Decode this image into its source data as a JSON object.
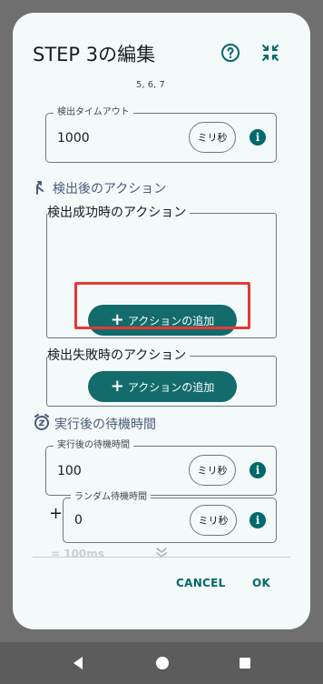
{
  "dialog": {
    "title": "STEP 3の編集",
    "help_icon": "help-circle-icon",
    "shrink_icon": "collapse-arrows-icon"
  },
  "partial_text": "5, 6, 7",
  "detection_timeout": {
    "label": "検出タイムアウト",
    "value": "1000",
    "unit": "ミリ秒",
    "info_icon": "info-icon"
  },
  "after_detection": {
    "title": "検出後のアクション",
    "icon": "branch-arrow-icon",
    "success": {
      "label": "検出成功時のアクション",
      "add_button": "アクションの追加"
    },
    "failure": {
      "label": "検出失敗時のアクション",
      "add_button": "アクションの追加"
    }
  },
  "wait": {
    "title": "実行後の待機時間",
    "icon": "alarm-snooze-icon",
    "wait_field": {
      "label": "実行後の待機時間",
      "value": "100",
      "unit": "ミリ秒"
    },
    "random_field": {
      "prefix": "+",
      "label": "ランダム待機時間",
      "value": "0",
      "unit": "ミリ秒"
    },
    "result": "= 100ms",
    "expand_icon": "double-chevron-down-icon"
  },
  "actions": {
    "cancel": "CANCEL",
    "ok": "OK"
  },
  "navbar": {
    "back_icon": "back-triangle-icon",
    "home_icon": "home-circle-icon",
    "recents_icon": "recents-square-icon"
  },
  "colors": {
    "accent": "#136b6c",
    "dialog_bg": "#f4fafa",
    "highlight": "#e53935"
  }
}
